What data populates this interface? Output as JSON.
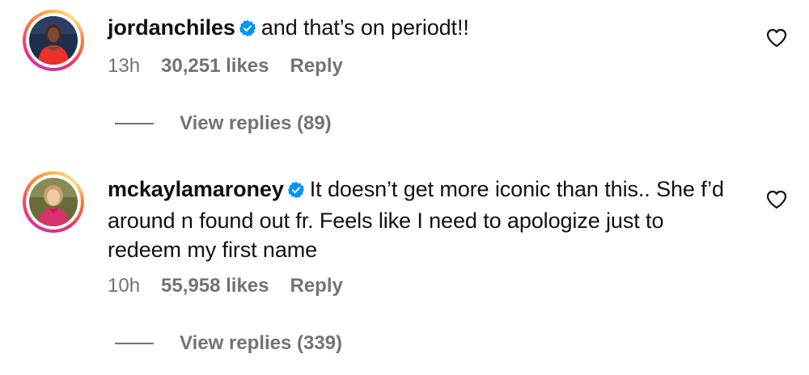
{
  "comments": [
    {
      "username": "jordanchiles",
      "text": "and that’s on periodt!!",
      "time": "13h",
      "likes": "30,251 likes",
      "reply_label": "Reply",
      "view_replies": "View replies (89)",
      "verified_icon": "verified-badge-icon",
      "like_icon": "heart-outline-icon"
    },
    {
      "username": "mckaylamaroney",
      "text": "It doesn’t get more iconic than this.. She f’d around n found out fr. Feels like I need to apologize just to redeem my first name",
      "time": "10h",
      "likes": "55,958 likes",
      "reply_label": "Reply",
      "view_replies": "View replies (339)",
      "verified_icon": "verified-badge-icon",
      "like_icon": "heart-outline-icon"
    }
  ],
  "colors": {
    "primary_text": "#111111",
    "secondary_text": "#737373",
    "verified_blue": "#0095f6"
  }
}
